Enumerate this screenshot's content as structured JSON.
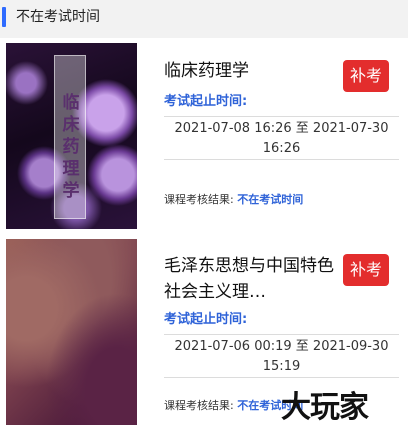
{
  "section": {
    "title": "不在考试时间"
  },
  "courses": [
    {
      "name": "临床药理学",
      "thumbnail_text": "临床药理学",
      "action_label": "补考",
      "time_label": "考试起止时间:",
      "time_range_line1": "2021-07-08 16:26 至 2021-07-30",
      "time_range_line2": "16:26",
      "result_label": "课程考核结果:",
      "result_value": "不在考试时间"
    },
    {
      "name": "毛泽东思想与中国特色社会主义理…",
      "action_label": "补考",
      "time_label": "考试起止时间:",
      "time_range_line1": "2021-07-06 00:19 至 2021-09-30",
      "time_range_line2": "15:19",
      "result_label": "课程考核结果:",
      "result_value": "不在考试时间"
    }
  ],
  "watermark": "大玩家"
}
